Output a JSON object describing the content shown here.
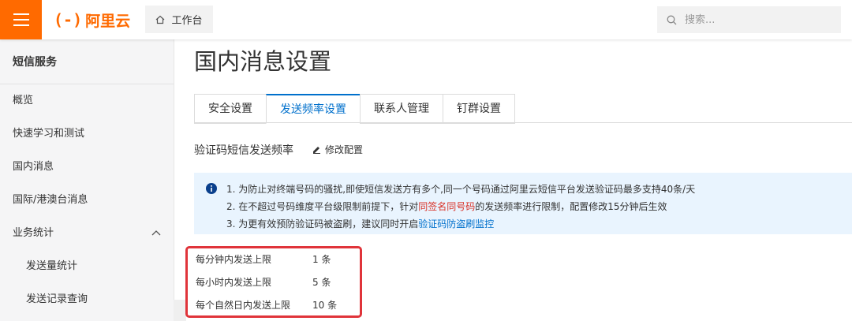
{
  "header": {
    "logo_mark": "(-)",
    "logo_text": "阿里云",
    "workbench_label": "工作台",
    "search_placeholder": "搜索..."
  },
  "sidebar": {
    "title": "短信服务",
    "items": [
      {
        "label": "概览"
      },
      {
        "label": "快速学习和测试"
      },
      {
        "label": "国内消息"
      },
      {
        "label": "国际/港澳台消息"
      },
      {
        "label": "业务统计"
      },
      {
        "label": "发送量统计"
      },
      {
        "label": "发送记录查询"
      }
    ]
  },
  "main": {
    "title": "国内消息设置",
    "tabs": [
      {
        "label": "安全设置"
      },
      {
        "label": "发送频率设置"
      },
      {
        "label": "联系人管理"
      },
      {
        "label": "钉群设置"
      }
    ],
    "section_title": "验证码短信发送频率",
    "edit_label": "修改配置",
    "notice": {
      "line1": "1. 为防止对终端号码的骚扰,即使短信发送方有多个,同一个号码通过阿里云短信平台发送验证码最多支持40条/天",
      "line2_pre": "2. 在不超过号码维度平台级限制前提下，针对",
      "line2_highlight": "同签名同号码",
      "line2_post": "的发送频率进行限制，配置修改15分钟后生效",
      "line3_pre": "3. 为更有效预防验证码被盗刷，建议同时开启",
      "line3_link": "验证码防盗刷监控"
    },
    "limits": [
      {
        "label": "每分钟内发送上限",
        "value": "1 条"
      },
      {
        "label": "每小时内发送上限",
        "value": "5 条"
      },
      {
        "label": "每个自然日内发送上限",
        "value": "10 条"
      }
    ]
  },
  "colors": {
    "brand": "#ff6a00",
    "accent_blue": "#0070cc",
    "highlight_red": "#e0343a",
    "notice_bg": "#e9f4fe"
  }
}
